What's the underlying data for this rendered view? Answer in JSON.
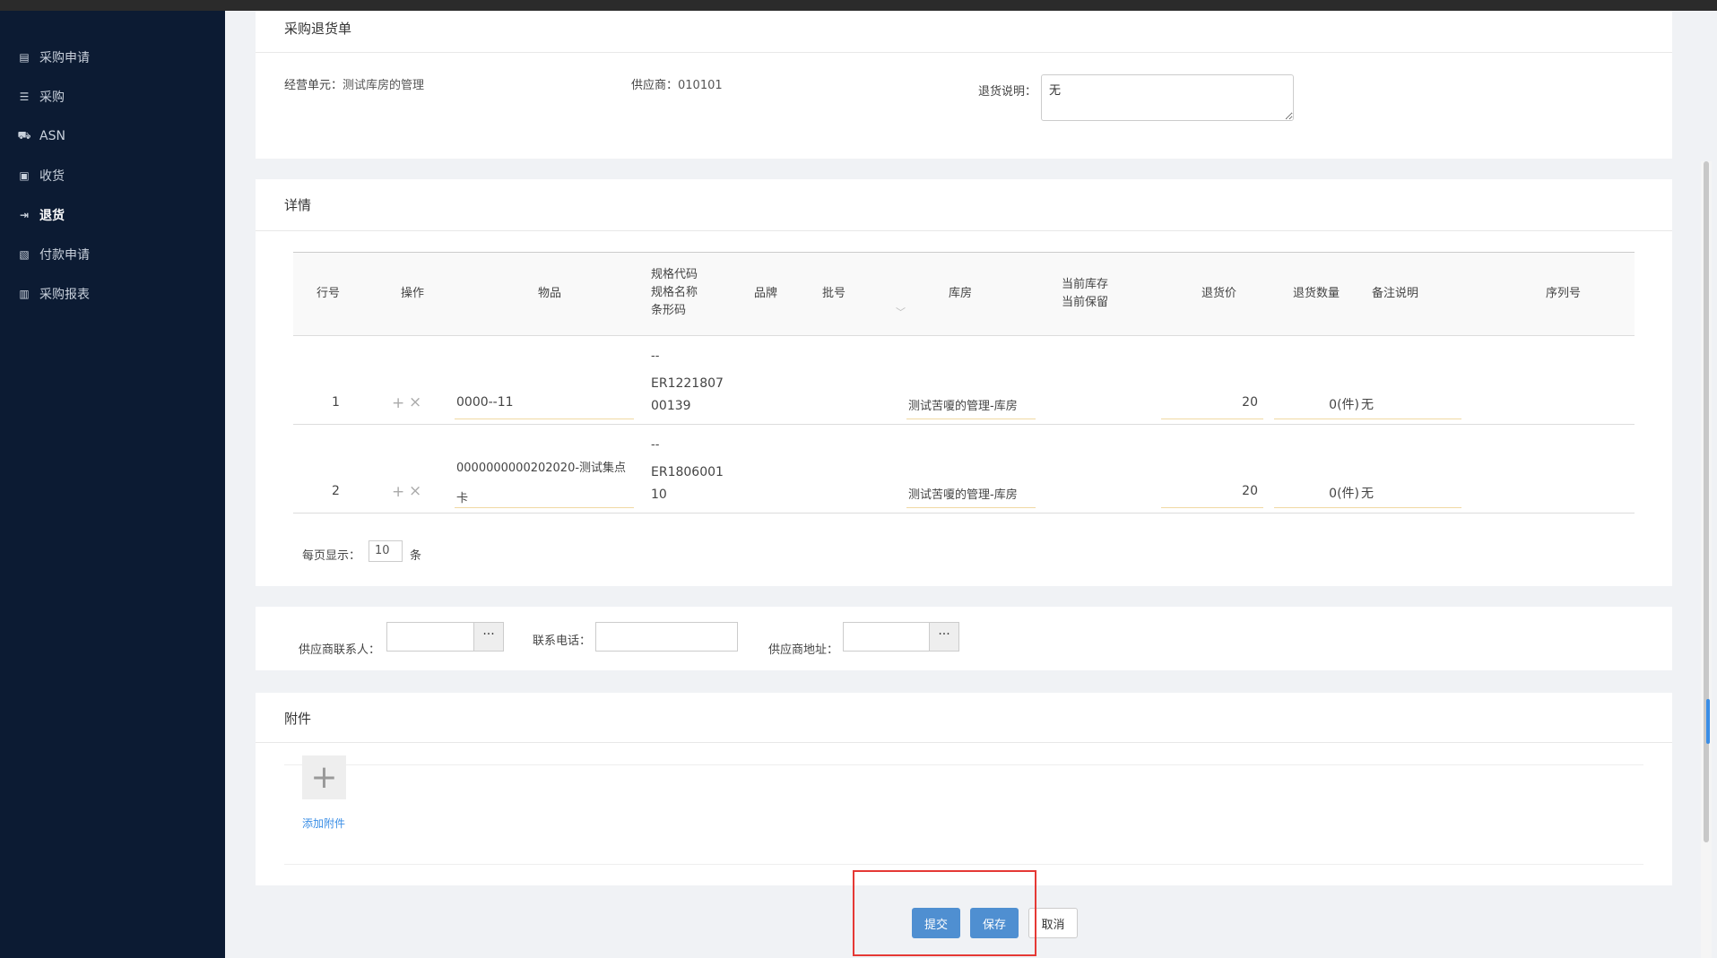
{
  "sidebar": {
    "items": [
      {
        "label": "采购申请",
        "icon": "document-icon",
        "active": false
      },
      {
        "label": "采购",
        "icon": "list-icon",
        "active": false
      },
      {
        "label": "ASN",
        "icon": "truck-icon",
        "active": false
      },
      {
        "label": "收货",
        "icon": "inbox-icon",
        "active": false
      },
      {
        "label": "退货",
        "icon": "return-icon",
        "active": true
      },
      {
        "label": "付款申请",
        "icon": "payment-icon",
        "active": false
      },
      {
        "label": "采购报表",
        "icon": "chart-icon",
        "active": false
      }
    ]
  },
  "header_card": {
    "title": "采购退货单",
    "business_unit_label": "经营单元：",
    "business_unit_value": "测试库房的管理",
    "supplier_label": "供应商：",
    "supplier_value": "010101",
    "return_note_label": "退货说明：",
    "return_note_value": "无"
  },
  "detail_card": {
    "title": "详情",
    "columns": {
      "row_no": "行号",
      "action": "操作",
      "item": "物品",
      "spec_line1": "规格代码",
      "spec_line2": "规格名称",
      "spec_line3": "条形码",
      "brand": "品牌",
      "batch": "批号",
      "warehouse": "库房",
      "stock_line1": "当前库存",
      "stock_line2": "当前保留",
      "return_price": "退货价",
      "return_qty": "退货数量",
      "remark": "备注说明",
      "serial": "序列号"
    },
    "rows": [
      {
        "row_no": "1",
        "item_line1": "0000--11",
        "item_line2": "",
        "spec_dash": "--",
        "barcode_line1": "ER1221807",
        "barcode_line2": "00139",
        "warehouse": "测试苦嗄的管理-库房",
        "price": "20",
        "qty": "0(件)",
        "remark": "无"
      },
      {
        "row_no": "2",
        "item_line1": "0000000000202020-测试集点",
        "item_line2": "卡",
        "spec_dash": "--",
        "barcode_line1": "ER1806001",
        "barcode_line2": "10",
        "warehouse": "测试苦嗄的管理-库房",
        "price": "20",
        "qty": "0(件)",
        "remark": "无"
      }
    ],
    "action_add": "+",
    "action_remove": "×",
    "pager_label": "每页显示：",
    "pager_value": "10",
    "pager_unit": "条"
  },
  "contact_card": {
    "contact_label": "供应商联系人：",
    "phone_label": "联系电话：",
    "address_label": "供应商地址：",
    "dots": "···"
  },
  "attachment_card": {
    "title": "附件",
    "add_icon": "+",
    "add_label": "添加附件"
  },
  "buttons": {
    "submit": "提交",
    "save": "保存",
    "cancel": "取消"
  },
  "colors": {
    "sidebar_bg": "#0c1b33",
    "primary": "#4f8fd1",
    "highlight": "#e53935"
  }
}
